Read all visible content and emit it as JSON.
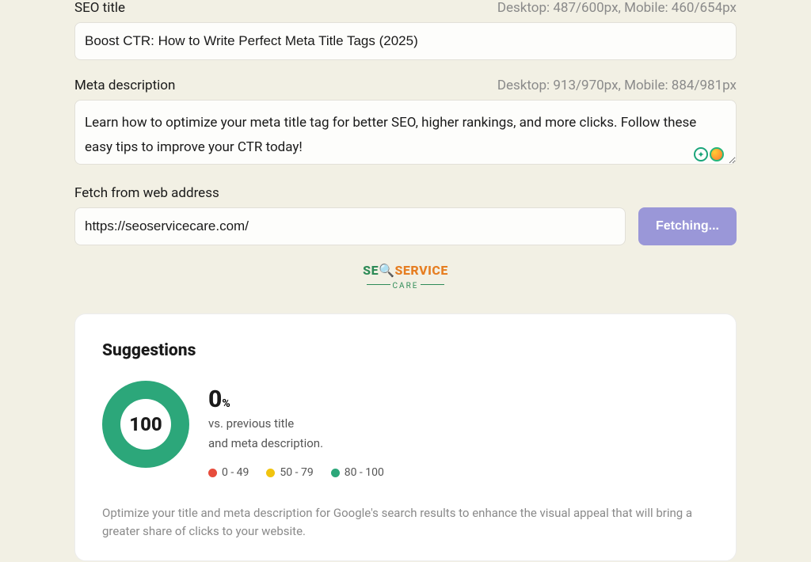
{
  "seo_title": {
    "label": "SEO title",
    "counter": "Desktop: 487/600px, Mobile: 460/654px",
    "value": "Boost CTR: How to Write Perfect Meta Title Tags (2025)"
  },
  "meta_description": {
    "label": "Meta description",
    "counter": "Desktop: 913/970px, Mobile: 884/981px",
    "value": "Learn how to optimize your meta title tag for better SEO, higher rankings, and more clicks. Follow these easy tips to improve your CTR today!"
  },
  "fetch": {
    "label": "Fetch from web address",
    "value": "https://seoservicecare.com/",
    "button": "Fetching..."
  },
  "logo": {
    "seo": "SE",
    "service": "SERVICE",
    "care": "CARE"
  },
  "suggestions": {
    "title": "Suggestions",
    "score": "100",
    "delta": "0",
    "pct": "%",
    "vs_line1": "vs. previous title",
    "vs_line2": "and meta description.",
    "legend": {
      "low": "0 - 49",
      "mid": "50 - 79",
      "high": "80 - 100"
    },
    "hint": "Optimize your title and meta description for Google's search results to enhance the visual appeal that will bring a greater share of clicks to your website."
  }
}
